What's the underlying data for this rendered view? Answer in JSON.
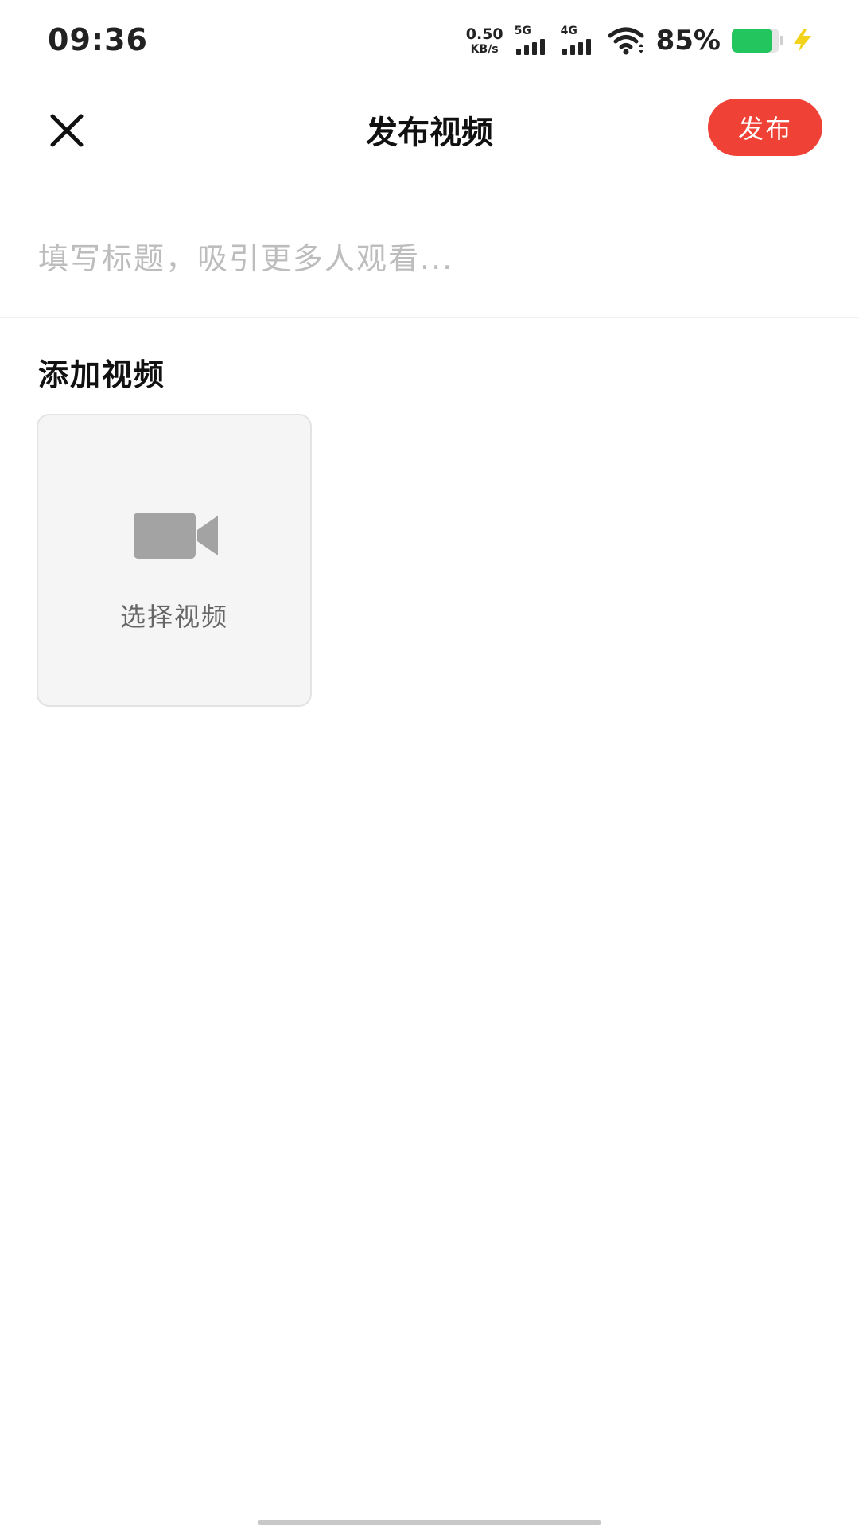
{
  "status_bar": {
    "time": "09:36",
    "net_speed_value": "0.50",
    "net_speed_unit": "KB/s",
    "signal_1_label": "5G",
    "signal_2_label": "4G",
    "battery_text": "85%",
    "battery_level": 0.85,
    "battery_color": "#22c55e",
    "charging_icon": "lightning-bolt-icon"
  },
  "nav": {
    "close_icon": "close-icon",
    "title": "发布视频",
    "publish_label": "发布",
    "publish_color": "#ef4136"
  },
  "title_field": {
    "placeholder": "填写标题，吸引更多人观看...",
    "value": ""
  },
  "add_video": {
    "section_title": "添加视频",
    "picker_icon": "video-camera-icon",
    "picker_label": "选择视频"
  }
}
